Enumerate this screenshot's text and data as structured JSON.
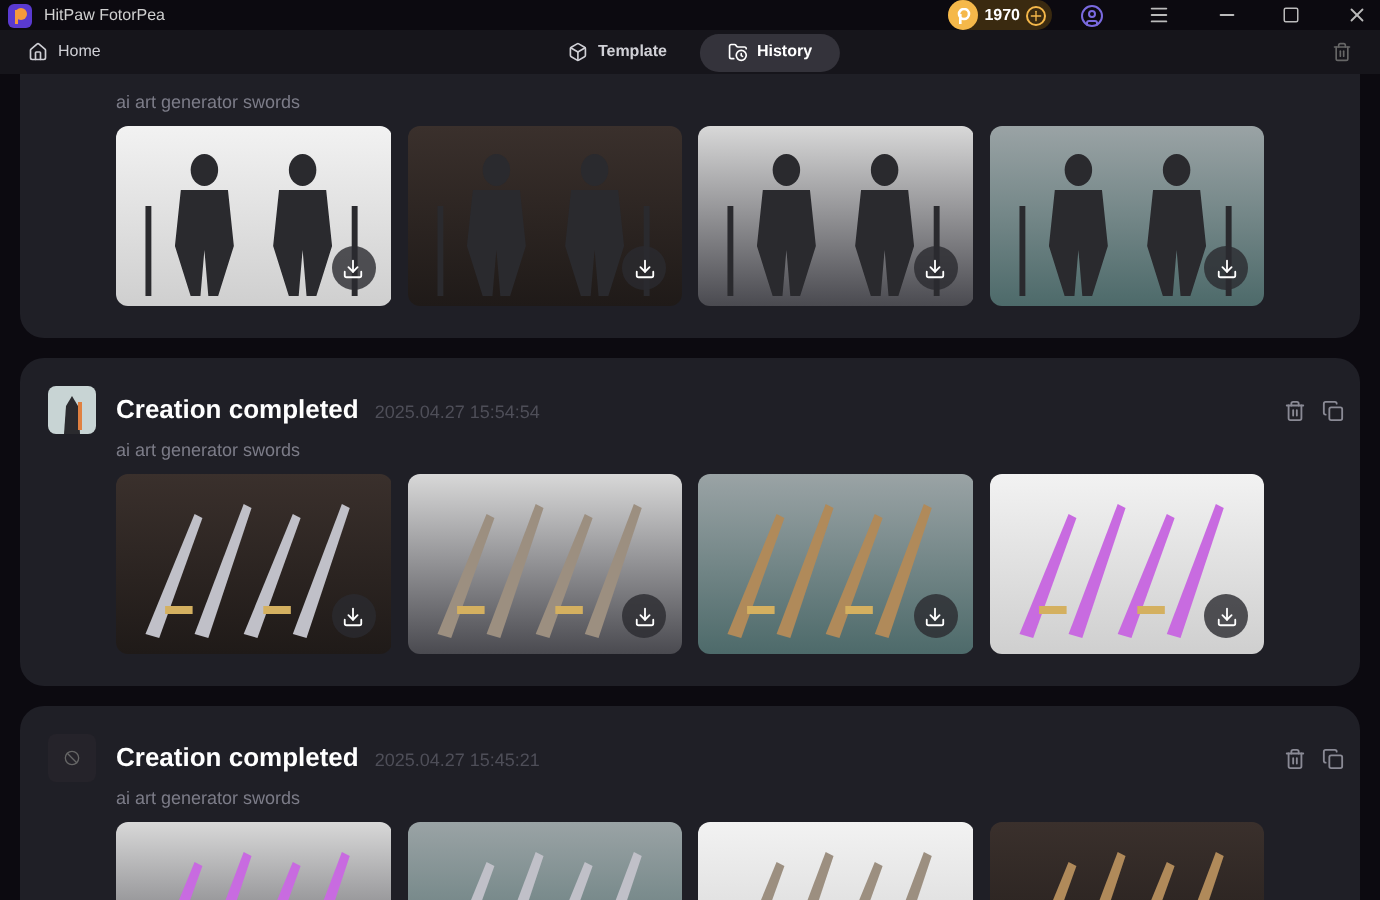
{
  "window": {
    "title": "HitPaw FotorPea",
    "coins": "1970"
  },
  "nav": {
    "home": "Home",
    "tabs": [
      {
        "label": "Template",
        "selected": false
      },
      {
        "label": "History",
        "selected": true
      }
    ]
  },
  "cards": [
    {
      "subtitle": "ai art generator swords",
      "images": [
        {
          "kind": "picture",
          "download_button": true
        },
        {
          "kind": "picture",
          "download_button": true
        },
        {
          "kind": "picture",
          "download_button": true
        },
        {
          "kind": "picture",
          "download_button": true
        }
      ]
    },
    {
      "title": "Creation completed",
      "time": "2025.04.27 15:54:54",
      "thumb": {
        "kind": "picture"
      },
      "subtitle": "ai art generator swords",
      "images": [
        {
          "kind": "picture",
          "download_button": true
        },
        {
          "kind": "picture",
          "download_button": true
        },
        {
          "kind": "picture",
          "download_button": true
        },
        {
          "kind": "picture",
          "download_button": true
        }
      ]
    },
    {
      "title": "Creation completed",
      "time": "2025.04.27 15:45:21",
      "thumb": {
        "kind": "blocked"
      },
      "subtitle": "ai art generator swords",
      "images": [
        {
          "kind": "picture"
        },
        {
          "kind": "picture"
        },
        {
          "kind": "picture"
        },
        {
          "kind": "picture"
        }
      ]
    }
  ]
}
